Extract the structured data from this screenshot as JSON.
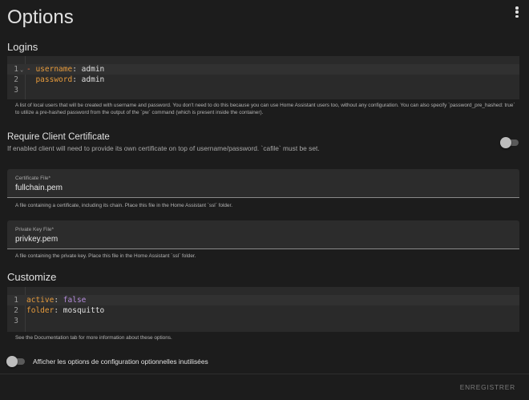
{
  "page": {
    "title": "Options"
  },
  "logins": {
    "title": "Logins",
    "code": [
      {
        "n": "1",
        "dash": "- ",
        "key": "username",
        "punc": ": ",
        "val": "admin"
      },
      {
        "n": "2",
        "dash": "  ",
        "key": "password",
        "punc": ": ",
        "val": "admin"
      },
      {
        "n": "3",
        "dash": "",
        "key": "",
        "punc": "",
        "val": ""
      }
    ],
    "helper": "A list of local users that will be created with username and password. You don't need to do this because you can use Home Assistant users too, without any configuration. You can also specify `password_pre_hashed: true` to utilize a pre-hashed password from the output of the `pw` command (which is present inside the container)."
  },
  "require_cert": {
    "title": "Require Client Certificate",
    "description": "If enabled client will need to provide its own certificate on top of username/password. `cafile` must be set.",
    "enabled": false
  },
  "certfile": {
    "label": "Certificate File*",
    "value": "fullchain.pem",
    "helper": "A file containing a certificate, including its chain. Place this file in the Home Assistant `ssl` folder."
  },
  "keyfile": {
    "label": "Private Key File*",
    "value": "privkey.pem",
    "helper": "A file containing the private key. Place this file in the Home Assistant `ssl` folder."
  },
  "customize": {
    "title": "Customize",
    "code": [
      {
        "n": "1",
        "key": "active",
        "punc": ": ",
        "val": "false",
        "val_type": "bool"
      },
      {
        "n": "2",
        "key": "folder",
        "punc": ": ",
        "val": "mosquitto",
        "val_type": "string"
      },
      {
        "n": "3",
        "key": "",
        "punc": "",
        "val": ""
      }
    ],
    "helper": "See the Documentation tab for more information about these options."
  },
  "show_unused": {
    "label": "Afficher les options de configuration optionnelles inutilisées",
    "enabled": false
  },
  "actions": {
    "save_label": "ENREGISTRER"
  },
  "colors": {
    "background": "#1c1c1c",
    "code_background": "#2a2a2a",
    "yaml_key": "#e59a3c",
    "yaml_dash": "#e06c40",
    "yaml_bool": "#b58cdc"
  },
  "icons": {
    "menu": "dots-vertical-icon",
    "fold": "chevron-down-icon"
  }
}
